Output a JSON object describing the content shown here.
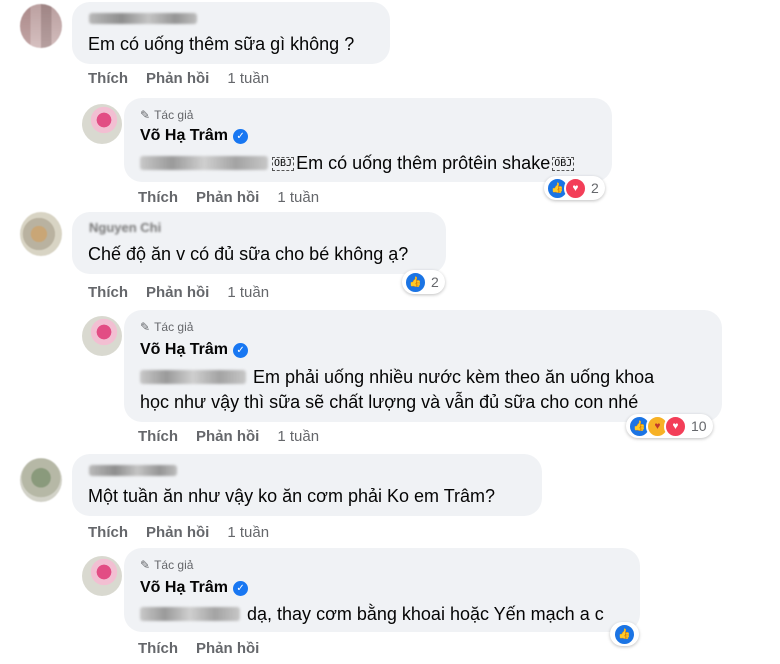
{
  "comments": [
    {
      "text": "Em có uống thêm sữa gì không ?",
      "actions": {
        "like": "Thích",
        "reply": "Phản hồi",
        "time": "1 tuần"
      }
    },
    {
      "author_label": "Tác giả",
      "name": "Võ Hạ Trâm",
      "tag": "OBJ",
      "text": "Em có uống thêm prôtêin shake",
      "tag2": "OBJ",
      "actions": {
        "like": "Thích",
        "reply": "Phản hồi",
        "time": "1 tuần"
      },
      "reaction_count": "2"
    },
    {
      "name": "Nguyen Chi",
      "text": "Chế độ ăn v có đủ sữa cho bé không ạ?",
      "actions": {
        "like": "Thích",
        "reply": "Phản hồi",
        "time": "1 tuần"
      },
      "reaction_count": "2"
    },
    {
      "author_label": "Tác giả",
      "name": "Võ Hạ Trâm",
      "text_line1": "Em phải uống nhiều nước kèm theo ăn uống khoa",
      "text_line2": "học như vậy thì sữa sẽ chất lượng và vẫn đủ sữa cho con nhé",
      "actions": {
        "like": "Thích",
        "reply": "Phản hồi",
        "time": "1 tuần"
      },
      "reaction_count": "10"
    },
    {
      "text": "Một tuần ăn như vậy ko ăn cơm phải Ko em Trâm?",
      "actions": {
        "like": "Thích",
        "reply": "Phản hồi",
        "time": "1 tuần"
      }
    },
    {
      "author_label": "Tác giả",
      "name": "Võ Hạ Trâm",
      "text": "dạ, thay cơm bằng khoai hoặc Yến mạch a c",
      "actions": {
        "like": "Thích",
        "reply": "Phản hồi"
      }
    }
  ],
  "icons": {
    "verified": "verified-badge-icon",
    "author": "pen-icon",
    "like": "like-reaction-icon",
    "love": "love-reaction-icon",
    "care": "care-reaction-icon"
  },
  "colors": {
    "bubble": "#f0f2f5",
    "meta": "#65676b",
    "like": "#1b74e4",
    "love": "#f33e58",
    "verified": "#1877f2"
  }
}
